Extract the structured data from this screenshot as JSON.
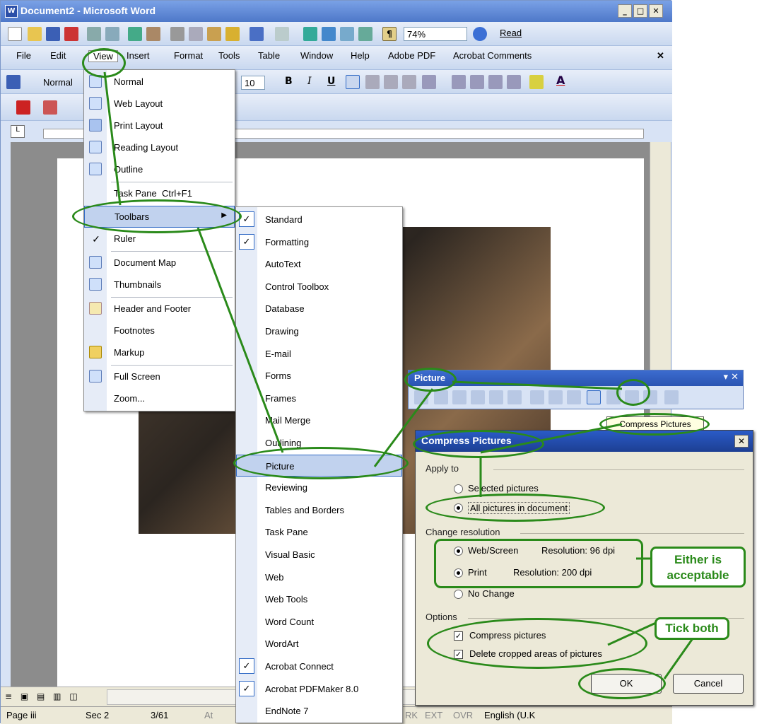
{
  "window": {
    "title": "Document2 - Microsoft Word"
  },
  "menubar": [
    "File",
    "Edit",
    "View",
    "Insert",
    "Format",
    "Tools",
    "Table",
    "Window",
    "Help",
    "Adobe PDF",
    "Acrobat Comments"
  ],
  "formatting": {
    "style": "Normal",
    "font_size": "10",
    "zoom": "74%",
    "read_label": "Read"
  },
  "view_menu": {
    "items": [
      {
        "label": "Normal",
        "icon": "normal-view-icon"
      },
      {
        "label": "Web Layout",
        "icon": "web-layout-icon"
      },
      {
        "label": "Print Layout",
        "icon": "print-layout-icon"
      },
      {
        "label": "Reading Layout",
        "icon": "reading-layout-icon"
      },
      {
        "label": "Outline",
        "icon": "outline-icon"
      },
      {
        "label": "Task Pane",
        "shortcut": "Ctrl+F1"
      },
      {
        "label": "Toolbars"
      },
      {
        "label": "Ruler",
        "checked": true
      },
      {
        "label": "Document Map",
        "icon": "document-map-icon"
      },
      {
        "label": "Thumbnails",
        "icon": "thumbnails-icon"
      },
      {
        "label": "Header and Footer",
        "icon": "header-footer-icon"
      },
      {
        "label": "Footnotes"
      },
      {
        "label": "Markup",
        "icon": "markup-icon"
      },
      {
        "label": "Full Screen",
        "icon": "full-screen-icon"
      },
      {
        "label": "Zoom..."
      }
    ]
  },
  "toolbars_menu": {
    "items": [
      {
        "label": "Standard",
        "checked": true
      },
      {
        "label": "Formatting",
        "checked": true
      },
      {
        "label": "AutoText"
      },
      {
        "label": "Control Toolbox"
      },
      {
        "label": "Database"
      },
      {
        "label": "Drawing"
      },
      {
        "label": "E-mail"
      },
      {
        "label": "Forms"
      },
      {
        "label": "Frames"
      },
      {
        "label": "Mail Merge"
      },
      {
        "label": "Outlining"
      },
      {
        "label": "Picture"
      },
      {
        "label": "Reviewing"
      },
      {
        "label": "Tables and Borders"
      },
      {
        "label": "Task Pane"
      },
      {
        "label": "Visual Basic"
      },
      {
        "label": "Web"
      },
      {
        "label": "Web Tools"
      },
      {
        "label": "Word Count"
      },
      {
        "label": "WordArt"
      },
      {
        "label": "Acrobat Connect",
        "checked": true
      },
      {
        "label": "Acrobat PDFMaker 8.0",
        "checked": true
      },
      {
        "label": "EndNote 7"
      }
    ]
  },
  "picture_toolbar": {
    "title": "Picture",
    "tooltip": "Compress Pictures"
  },
  "dialog": {
    "title": "Compress Pictures",
    "apply_to_label": "Apply to",
    "selected_pictures": "Selected pictures",
    "all_pictures": "All pictures in document",
    "change_resolution_label": "Change resolution",
    "web_screen": "Web/Screen",
    "web_resolution": "Resolution:  96 dpi",
    "print": "Print",
    "print_resolution": "Resolution:  200 dpi",
    "no_change": "No Change",
    "options_label": "Options",
    "compress_pictures": "Compress pictures",
    "delete_cropped": "Delete cropped areas of pictures",
    "ok": "OK",
    "cancel": "Cancel"
  },
  "annotations": {
    "either": "Either is acceptable",
    "tick_both": "Tick both"
  },
  "status": {
    "page": "Page  iii",
    "sec": "Sec  2",
    "pages": "3/61",
    "at": "At",
    "rk": "RK",
    "ext": "EXT",
    "ovr": "OVR",
    "lang": "English (U.K"
  }
}
